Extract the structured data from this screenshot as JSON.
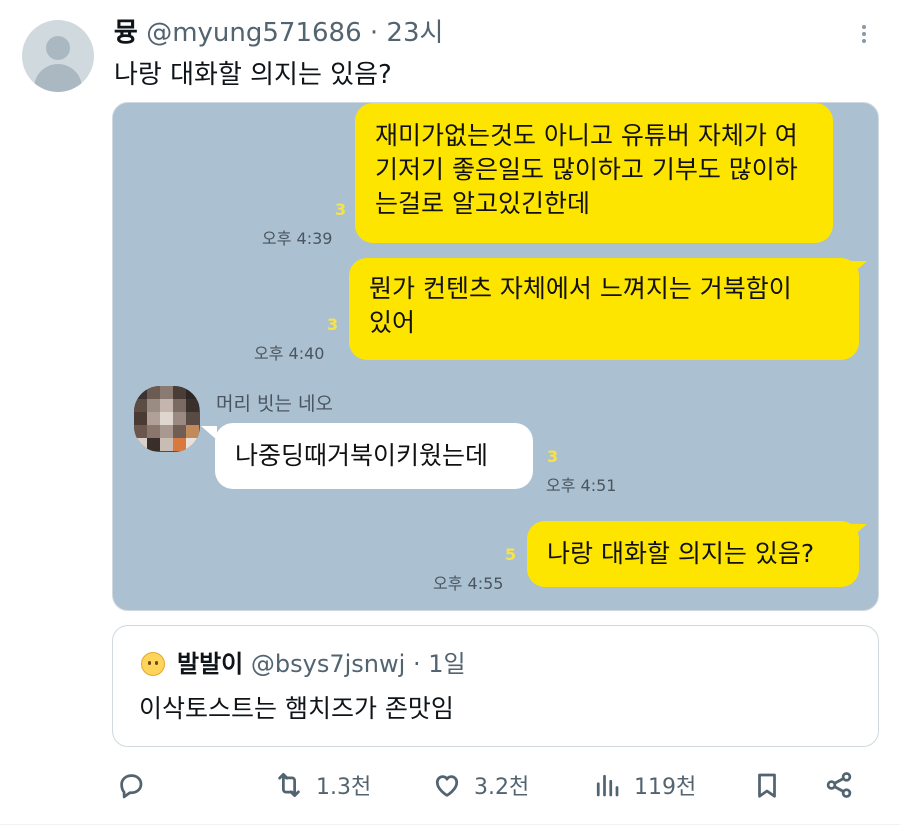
{
  "tweet": {
    "author_name": "뮹",
    "author_handle": "@myung571686",
    "separator": "·",
    "time": "23시",
    "text": "나랑 대화할 의지는 있음?"
  },
  "chat": {
    "messages": [
      {
        "side": "right",
        "lines": [
          "재미가없는것도 아니고 유튜버 자체가 여",
          "기저기 좋은일도 많이하고 기부도 많이하",
          "는걸로 알고있긴한데"
        ],
        "unread": "3",
        "time": "오후 4:39"
      },
      {
        "side": "right",
        "lines": [
          "뭔가 컨텐츠 자체에서 느껴지는 거북함이",
          "있어"
        ],
        "unread": "3",
        "time": "오후 4:40"
      },
      {
        "side": "left",
        "sender": "머리 빗는 네오",
        "lines": [
          "나중딩때거북이키웠는데"
        ],
        "unread": "3",
        "time": "오후 4:51"
      },
      {
        "side": "right",
        "lines": [
          "나랑 대화할 의지는 있음?"
        ],
        "unread": "5",
        "time": "오후 4:55"
      }
    ]
  },
  "quote": {
    "author_name": "발발이",
    "author_handle": "@bsys7jsnwj",
    "separator": "·",
    "time": "1일",
    "text": "이삭토스트는 햄치즈가 존맛임"
  },
  "actions": {
    "reply": {
      "icon": "reply-icon",
      "count": ""
    },
    "retweet": {
      "icon": "retweet-icon",
      "count": "1.3천"
    },
    "like": {
      "icon": "heart-icon",
      "count": "3.2천"
    },
    "views": {
      "icon": "views-icon",
      "count": "119천"
    },
    "bookmark": {
      "icon": "bookmark-icon",
      "count": ""
    },
    "share": {
      "icon": "share-icon",
      "count": ""
    }
  },
  "colors": {
    "chat_background": "#abc1d1",
    "kakao_yellow": "#fee500",
    "text_secondary": "#536471"
  }
}
